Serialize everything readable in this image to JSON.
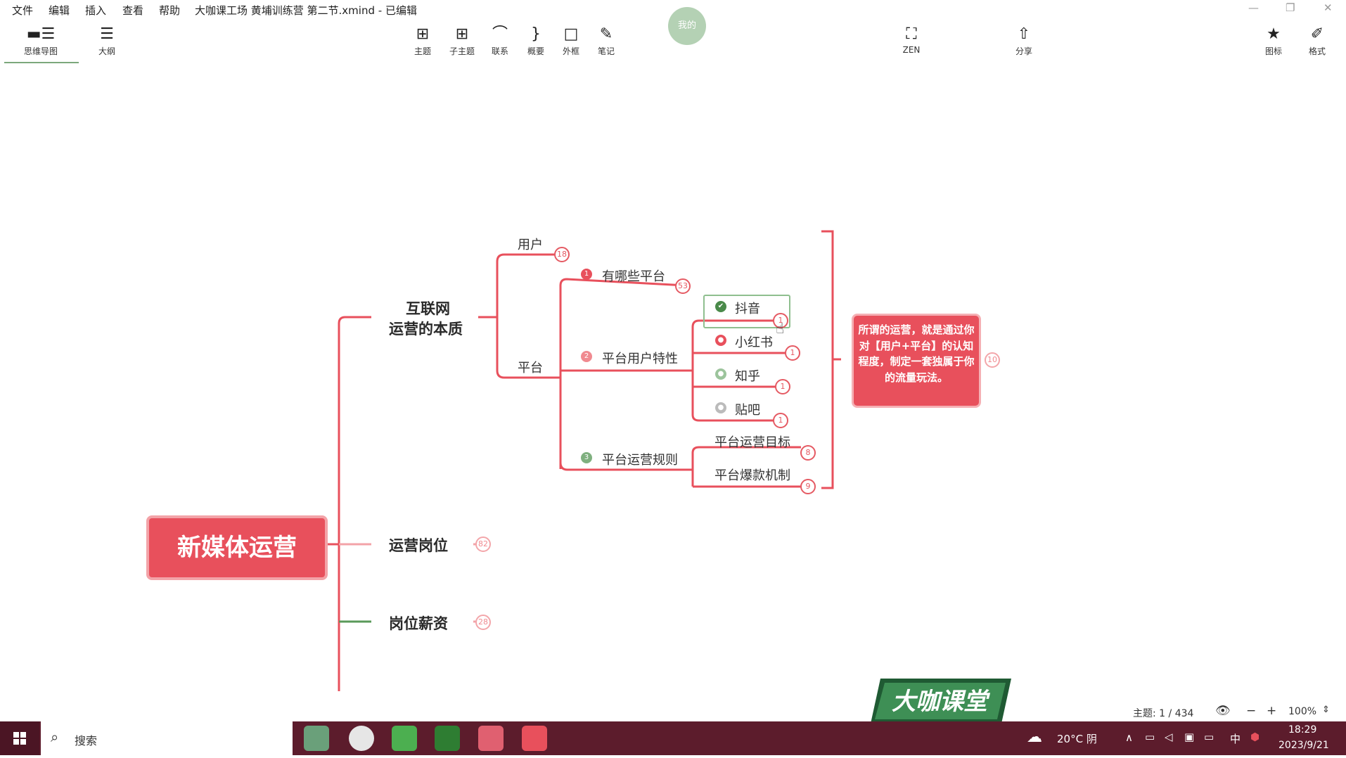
{
  "menubar": {
    "file": "文件",
    "edit": "编辑",
    "insert": "插入",
    "view": "查看",
    "help": "帮助",
    "title": "大咖课工场 黄埔训练营 第二节.xmind - 已编辑"
  },
  "toolbar": {
    "mindmap": "思维导图",
    "outline": "大纲",
    "topic": "主题",
    "subtopic": "子主题",
    "relation": "联系",
    "summary": "概要",
    "boundary": "外框",
    "note": "笔记",
    "zen": "ZEN",
    "share": "分享",
    "icon": "图标",
    "format": "格式"
  },
  "avatar": "我的",
  "mindmap": {
    "root": "新媒体运营",
    "branch1": {
      "line1": "互联网",
      "line2": "运营的本质"
    },
    "user": {
      "label": "用户",
      "count": "18"
    },
    "platform": {
      "label": "平台"
    },
    "which": {
      "marker": "1",
      "label": "有哪些平台",
      "count": "53"
    },
    "traits": {
      "marker": "2",
      "label": "平台用户特性"
    },
    "rules": {
      "marker": "3",
      "label": "平台运营规则"
    },
    "douyin": {
      "label": "抖音",
      "count": "1"
    },
    "xhs": {
      "label": "小红书",
      "count": "1"
    },
    "zhihu": {
      "label": "知乎",
      "count": "1"
    },
    "tieba": {
      "label": "贴吧",
      "count": "1"
    },
    "goal": {
      "label": "平台运营目标",
      "count": "8"
    },
    "viral": {
      "label": "平台爆款机制",
      "count": "9"
    },
    "callout": {
      "text": "所谓的运营，就是通过你对【用户+平台】的认知程度，制定一套独属于你的流量玩法。",
      "count": "10"
    },
    "branch2": {
      "label": "运营岗位",
      "count": "82"
    },
    "branch3": {
      "label": "岗位薪资",
      "count": "28"
    }
  },
  "logo": "大咖课堂",
  "status": {
    "topics": "主题: 1 / 434",
    "zoom": "100%"
  },
  "taskbar": {
    "search": "搜索",
    "weather": "20°C 阴",
    "ime": "中",
    "time": "18:29",
    "date": "2023/9/21"
  },
  "colors": {
    "accent": "#e8505c",
    "taskbar": "#5c1c2c",
    "selection": "#8fbf8f"
  }
}
